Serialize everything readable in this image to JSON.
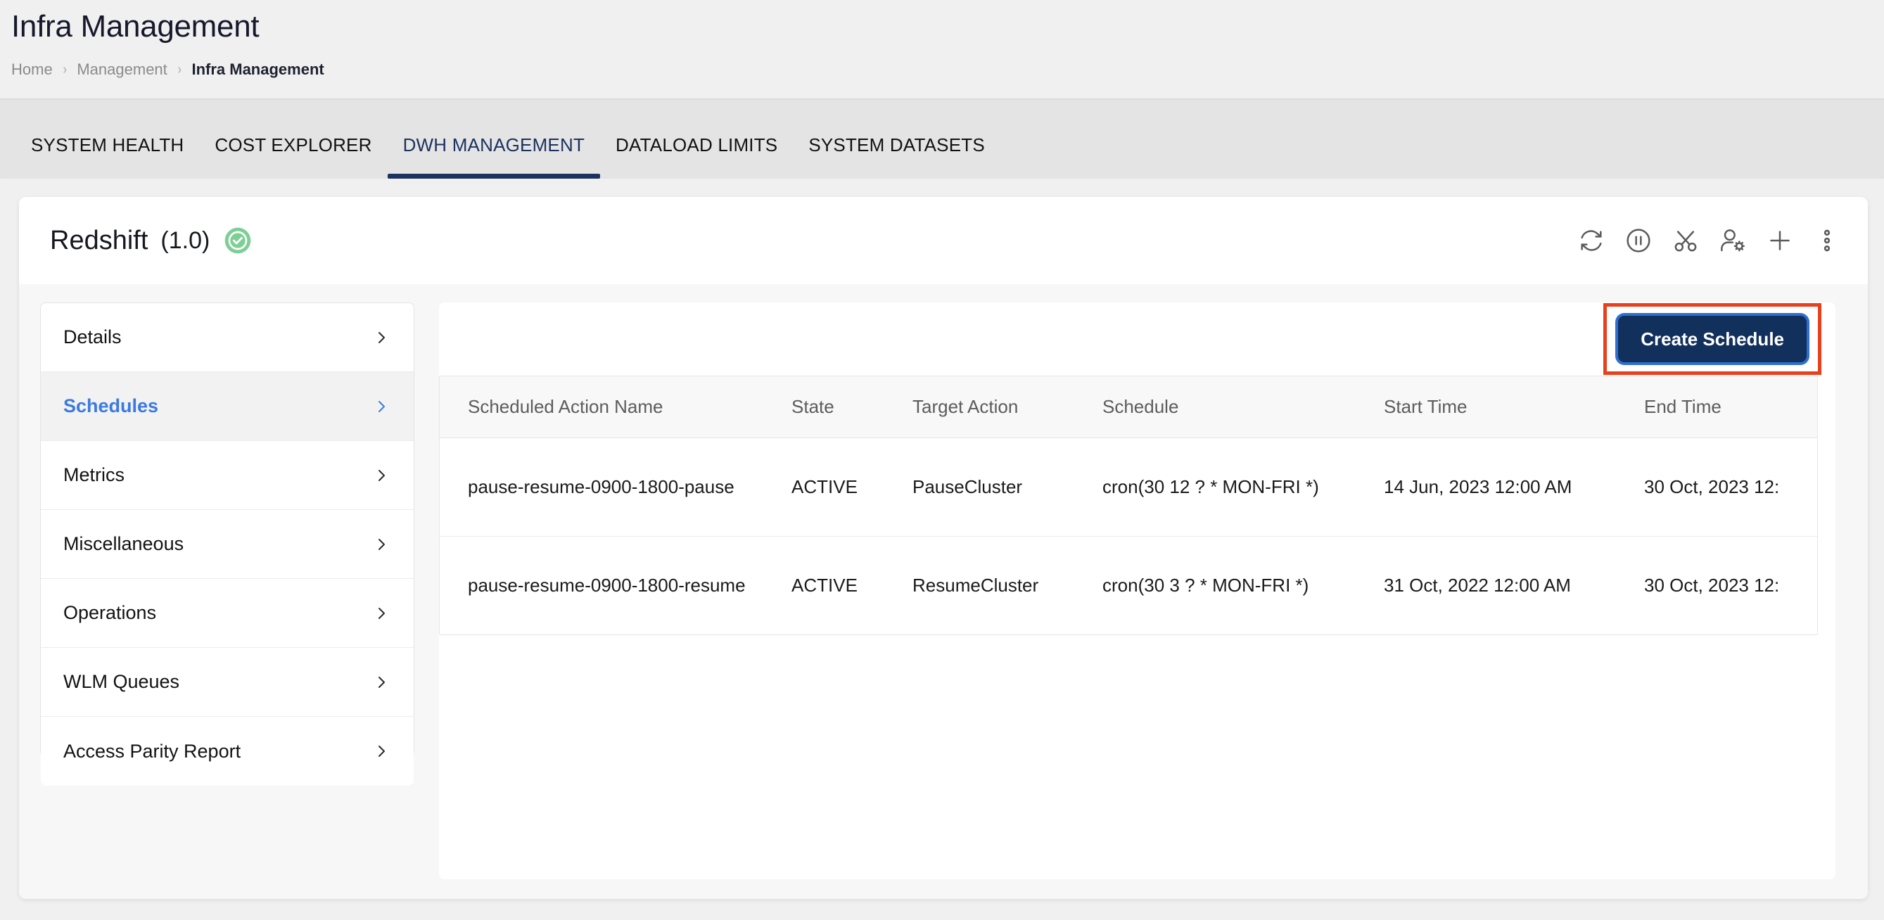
{
  "header": {
    "title": "Infra Management",
    "breadcrumb": [
      "Home",
      "Management",
      "Infra Management"
    ],
    "separator": "›"
  },
  "tabs": [
    {
      "label": "SYSTEM HEALTH",
      "active": false
    },
    {
      "label": "COST EXPLORER",
      "active": false
    },
    {
      "label": "DWH MANAGEMENT",
      "active": true
    },
    {
      "label": "DATALOAD LIMITS",
      "active": false
    },
    {
      "label": "SYSTEM DATASETS",
      "active": false
    }
  ],
  "cluster": {
    "name": "Redshift",
    "version": "(1.0)",
    "status_icon": "check-circle-icon",
    "status_color": "#7ecf96",
    "toolbar_icons": [
      "refresh-icon",
      "pause-circle-icon",
      "scissors-icon",
      "user-settings-icon",
      "plus-icon",
      "more-vertical-icon"
    ]
  },
  "sidebar": {
    "items": [
      {
        "label": "Details",
        "active": false
      },
      {
        "label": "Schedules",
        "active": true
      },
      {
        "label": "Metrics",
        "active": false
      },
      {
        "label": "Miscellaneous",
        "active": false
      },
      {
        "label": "Operations",
        "active": false
      },
      {
        "label": "WLM Queues",
        "active": false
      },
      {
        "label": "Access Parity Report",
        "active": false
      }
    ],
    "chevron_icon": "chevron-right-icon"
  },
  "panel": {
    "create_button_label": "Create Schedule",
    "highlight_color": "#e8401c",
    "button_color": "#12305c",
    "accent_color": "#3b7ae0"
  },
  "table": {
    "columns": [
      "Scheduled Action Name",
      "State",
      "Target Action",
      "Schedule",
      "Start Time",
      "End Time"
    ],
    "rows": [
      {
        "name": "pause-resume-0900-1800-pause",
        "state": "ACTIVE",
        "target": "PauseCluster",
        "schedule": "cron(30 12 ? * MON-FRI *)",
        "start": "14 Jun, 2023 12:00 AM",
        "end": "30 Oct, 2023 12:"
      },
      {
        "name": "pause-resume-0900-1800-resume",
        "state": "ACTIVE",
        "target": "ResumeCluster",
        "schedule": "cron(30 3 ? * MON-FRI *)",
        "start": "31 Oct, 2022 12:00 AM",
        "end": "30 Oct, 2023 12:"
      }
    ]
  }
}
